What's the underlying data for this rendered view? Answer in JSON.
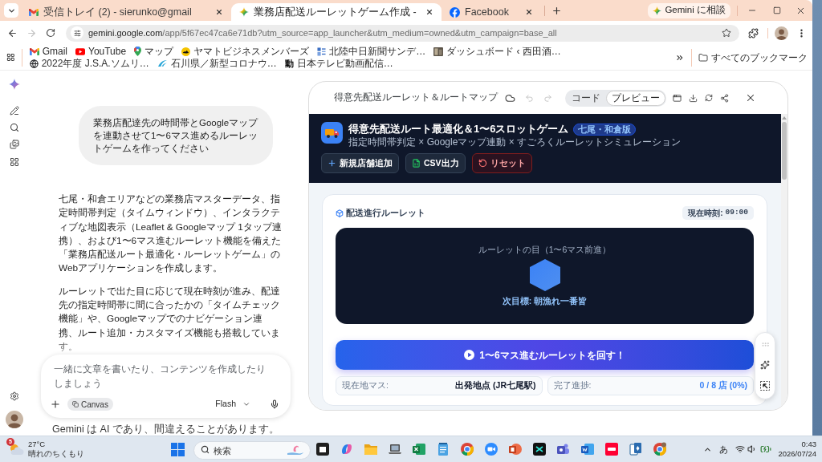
{
  "browser": {
    "tabs": [
      {
        "kind": "gmail",
        "title": "受信トレイ (2) - sierunko@gmail",
        "selected": false
      },
      {
        "kind": "gemini",
        "title": "業務店配送ルーレットゲーム作成 -",
        "selected": true
      },
      {
        "kind": "facebook",
        "title": "Facebook",
        "selected": false
      }
    ],
    "ask_button": "Gemini に相談",
    "back_disabled": false,
    "forward_disabled": true,
    "url_host": "gemini.google.com",
    "url_path": "/app/5f67ec47ca6e71db?utm_source=app_launcher&utm_medium=owned&utm_campaign=base_all",
    "bookmarks": [
      {
        "kind": "gmail",
        "label": "Gmail"
      },
      {
        "kind": "youtube",
        "label": "YouTube"
      },
      {
        "kind": "maps",
        "label": "マップ"
      },
      {
        "kind": "yamato",
        "label": "ヤマトビジネスメンバーズ"
      },
      {
        "kind": "news",
        "label": "北陸中日新聞サンデ…"
      },
      {
        "kind": "photo",
        "label": "ダッシュボード ‹ 西田酒…"
      },
      {
        "kind": "web",
        "label": "2022年度 J.S.A.ソムリ…"
      },
      {
        "kind": "pref",
        "label": "石川県／新型コロナウ…"
      },
      {
        "kind": "glyph",
        "glyph": "動",
        "label": "日本テレビ動画配信…"
      }
    ],
    "all_bookmarks": "すべてのブックマーク"
  },
  "chat": {
    "user_message": "業務店配達先の時間帯とGoogleマップを連動させて1〜6マス進めるルーレットゲームを作ってください",
    "response": [
      "七尾・和倉エリアなどの業務店マスターデータ、指定時間帯判定（タイムウィンドウ）、インタラクティブな地図表示（Leaflet & Googleマップ 1タップ連携）、および1〜6マス進むルーレット機能を備えた「業務店配送ルート最適化・ルーレットゲーム」のWebアプリケーションを作成します。",
      "ルーレットで出た目に応じて現在時刻が進み、配達先の指定時間帯に間に合ったかの「タイムチェック機能」や、Googleマップでのナビゲーション連携、ルート追加・カスタマイズ機能も搭載しています。"
    ],
    "composer": {
      "placeholder": "一緒に文章を書いたり、コンテンツを作成したりしましょう",
      "tool": "Canvas",
      "model": "Flash"
    },
    "disclaimer": "Gemini は AI であり、間違えることがあります。"
  },
  "canvas": {
    "title": "得意先配送ルーレット＆ルートマップ",
    "undo_disabled": true,
    "redo_disabled": true,
    "views": [
      {
        "label": "コード",
        "selected": false
      },
      {
        "label": "プレビュー",
        "selected": true
      }
    ],
    "app": {
      "title": "得意先配送ルート最適化＆1〜6スロットゲーム",
      "badge": "七尾・和倉版",
      "subtitle": "指定時間帯判定 × Googleマップ連動 × すごろくルーレットシミュレーション",
      "actions": [
        {
          "kind": "add",
          "label": "新規店舗追加"
        },
        {
          "kind": "csv",
          "label": "CSV出力"
        },
        {
          "kind": "reset",
          "label": "リセット"
        }
      ],
      "roulette": {
        "heading": "配送進行ルーレット",
        "clock_label": "現在時刻:",
        "clock": "09:00",
        "dice_caption": "ルーレットの目（1〜6マス前進）",
        "next_target": "次目標: 朝漁れ一番皆",
        "spin_button": "1〜6マス進むルーレットを回す！",
        "stats": [
          {
            "kind": "plain",
            "label": "現在地マス:",
            "value": "出発地点 (JR七尾駅)"
          },
          {
            "kind": "accent",
            "label": "完了進捗:",
            "value": "0 / 8 店 (0%)"
          }
        ]
      }
    }
  },
  "taskbar": {
    "weather": {
      "badge": "5",
      "temperature": "27°C",
      "condition": "晴れのちくもり"
    },
    "search": {
      "placeholder": "検索"
    },
    "ime": "あ",
    "time": "0:43",
    "date": "2026/07/24"
  }
}
